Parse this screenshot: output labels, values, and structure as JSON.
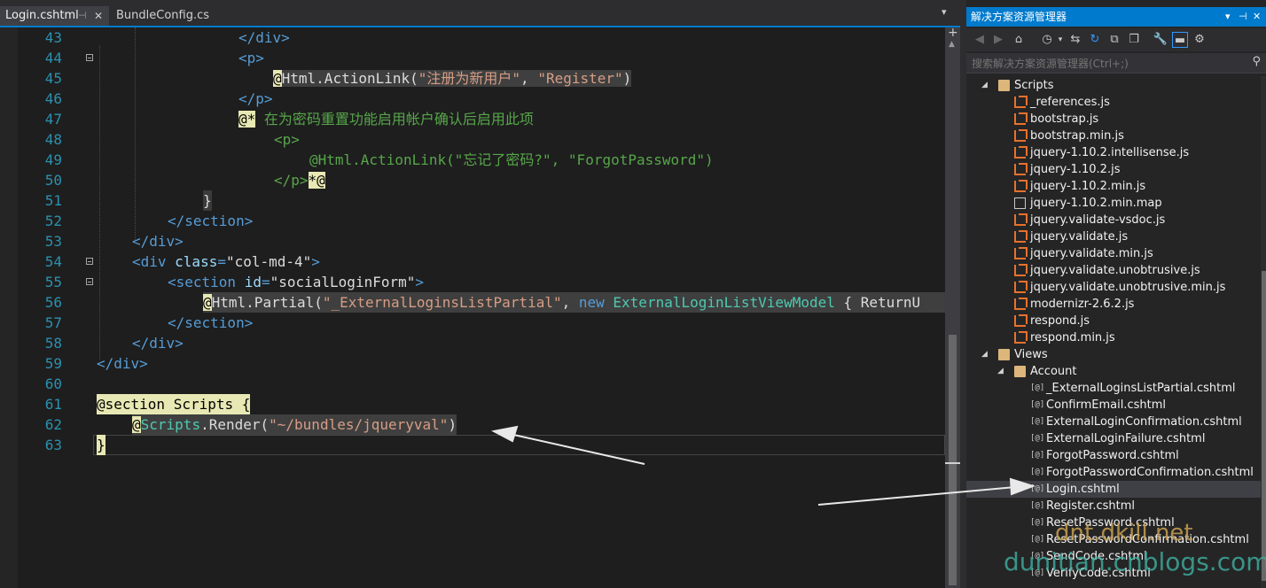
{
  "tabs": [
    {
      "label": "Login.cshtml",
      "active": true,
      "pin_icon": "pin-icon",
      "close_icon": "close-icon"
    },
    {
      "label": "BundleConfig.cs",
      "active": false
    }
  ],
  "editor": {
    "lines": [
      {
        "num": "43"
      },
      {
        "num": "44"
      },
      {
        "num": "45"
      },
      {
        "num": "46"
      },
      {
        "num": "47"
      },
      {
        "num": "48"
      },
      {
        "num": "49"
      },
      {
        "num": "50"
      },
      {
        "num": "51"
      },
      {
        "num": "52"
      },
      {
        "num": "53"
      },
      {
        "num": "54"
      },
      {
        "num": "55"
      },
      {
        "num": "56"
      },
      {
        "num": "57"
      },
      {
        "num": "58"
      },
      {
        "num": "59"
      },
      {
        "num": "60"
      },
      {
        "num": "61"
      },
      {
        "num": "62"
      },
      {
        "num": "63"
      }
    ],
    "tokens": {
      "l43": "</div>",
      "l44": "<p>",
      "l45_at": "@",
      "l45_a": "Html.ActionLink(",
      "l45_s1": "\"注册为新用户\"",
      "l45_c": ", ",
      "l45_s2": "\"Register\"",
      "l45_e": ")",
      "l46": "</p>",
      "l47_at": "@*",
      "l47_com": " 在为密码重置功能启用帐户确认后启用此项",
      "l48": "<p>",
      "l49": "@Html.ActionLink(\"忘记了密码?\", \"ForgotPassword\")",
      "l50_p": "</p>",
      "l50_end": "*@",
      "l51": "}",
      "l52": "</section>",
      "l53": "</div>",
      "l54_tag": "<div",
      "l54_attr": " class",
      "l54_eq": "=",
      "l54_val": "\"col-md-4\"",
      "l54_end": ">",
      "l55_tag": "<section",
      "l55_attr": " id",
      "l55_eq": "=",
      "l55_val": "\"socialLoginForm\"",
      "l55_end": ">",
      "l56_at": "@",
      "l56_a": "Html.Partial(",
      "l56_s": "\"_ExternalLoginsListPartial\"",
      "l56_c": ", ",
      "l56_kw": "new",
      "l56_sp": " ",
      "l56_type": "ExternalLoginListViewModel",
      "l56_rest": " { ReturnU",
      "l57": "</section>",
      "l58": "</div>",
      "l59": "</div>",
      "l61": "@section Scripts {",
      "l62_at": "@",
      "l62_type": "Scripts",
      "l62_a": ".Render(",
      "l62_s": "\"~/bundles/jqueryval\"",
      "l62_e": ")",
      "l63": "}"
    }
  },
  "explorer": {
    "title": "解决方案资源管理器",
    "search_placeholder": "搜索解决方案资源管理器(Ctrl+;)",
    "toolbar_icons": [
      "back-icon",
      "forward-icon",
      "home-icon",
      "history-icon",
      "sync-icon",
      "refresh-icon",
      "collapse-icon",
      "copy-icon",
      "properties-icon",
      "pending-changes-icon",
      "view-icon"
    ],
    "tree": [
      {
        "label": "Scripts",
        "type": "folder",
        "level": 2,
        "expanded": true
      },
      {
        "label": "_references.js",
        "type": "js",
        "level": 3
      },
      {
        "label": "bootstrap.js",
        "type": "js",
        "level": 3
      },
      {
        "label": "bootstrap.min.js",
        "type": "js",
        "level": 3
      },
      {
        "label": "jquery-1.10.2.intellisense.js",
        "type": "js",
        "level": 3
      },
      {
        "label": "jquery-1.10.2.js",
        "type": "js",
        "level": 3
      },
      {
        "label": "jquery-1.10.2.min.js",
        "type": "js",
        "level": 3
      },
      {
        "label": "jquery-1.10.2.min.map",
        "type": "file",
        "level": 3
      },
      {
        "label": "jquery.validate-vsdoc.js",
        "type": "js",
        "level": 3
      },
      {
        "label": "jquery.validate.js",
        "type": "js",
        "level": 3
      },
      {
        "label": "jquery.validate.min.js",
        "type": "js",
        "level": 3
      },
      {
        "label": "jquery.validate.unobtrusive.js",
        "type": "js",
        "level": 3
      },
      {
        "label": "jquery.validate.unobtrusive.min.js",
        "type": "js",
        "level": 3
      },
      {
        "label": "modernizr-2.6.2.js",
        "type": "js",
        "level": 3
      },
      {
        "label": "respond.js",
        "type": "js",
        "level": 3
      },
      {
        "label": "respond.min.js",
        "type": "js",
        "level": 3
      },
      {
        "label": "Views",
        "type": "folder",
        "level": 2,
        "expanded": true
      },
      {
        "label": "Account",
        "type": "folder",
        "level": 3,
        "expanded": true
      },
      {
        "label": "_ExternalLoginsListPartial.cshtml",
        "type": "cshtml",
        "level": 4
      },
      {
        "label": "ConfirmEmail.cshtml",
        "type": "cshtml",
        "level": 4
      },
      {
        "label": "ExternalLoginConfirmation.cshtml",
        "type": "cshtml",
        "level": 4
      },
      {
        "label": "ExternalLoginFailure.cshtml",
        "type": "cshtml",
        "level": 4
      },
      {
        "label": "ForgotPassword.cshtml",
        "type": "cshtml",
        "level": 4
      },
      {
        "label": "ForgotPasswordConfirmation.cshtml",
        "type": "cshtml",
        "level": 4
      },
      {
        "label": "Login.cshtml",
        "type": "cshtml",
        "level": 4,
        "selected": true
      },
      {
        "label": "Register.cshtml",
        "type": "cshtml",
        "level": 4
      },
      {
        "label": "ResetPassword.cshtml",
        "type": "cshtml",
        "level": 4
      },
      {
        "label": "ResetPasswordConfirmation.cshtml",
        "type": "cshtml",
        "level": 4
      },
      {
        "label": "SendCode.cshtml",
        "type": "cshtml",
        "level": 4
      },
      {
        "label": "VerifyCode.cshtml",
        "type": "cshtml",
        "level": 4
      }
    ]
  },
  "watermark": {
    "line1": "dnt.dkill.net",
    "line2": "dunitian.cnblogs.com"
  },
  "colors": {
    "accent": "#007acc",
    "editor_bg": "#1e1e1e",
    "line_number": "#2b91af",
    "html_tag": "#569cd6",
    "string": "#d69d85",
    "comment": "#57a64a",
    "type": "#4ec9b0"
  }
}
